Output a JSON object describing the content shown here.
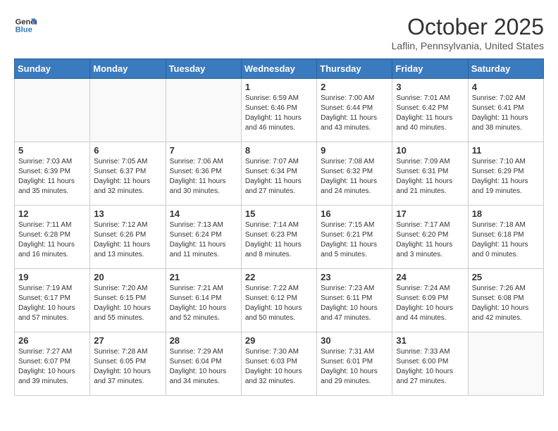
{
  "header": {
    "logo_line1": "General",
    "logo_line2": "Blue",
    "month_title": "October 2025",
    "subtitle": "Laflin, Pennsylvania, United States"
  },
  "weekdays": [
    "Sunday",
    "Monday",
    "Tuesday",
    "Wednesday",
    "Thursday",
    "Friday",
    "Saturday"
  ],
  "weeks": [
    [
      {
        "day": "",
        "info": ""
      },
      {
        "day": "",
        "info": ""
      },
      {
        "day": "",
        "info": ""
      },
      {
        "day": "1",
        "info": "Sunrise: 6:59 AM\nSunset: 6:46 PM\nDaylight: 11 hours\nand 46 minutes."
      },
      {
        "day": "2",
        "info": "Sunrise: 7:00 AM\nSunset: 6:44 PM\nDaylight: 11 hours\nand 43 minutes."
      },
      {
        "day": "3",
        "info": "Sunrise: 7:01 AM\nSunset: 6:42 PM\nDaylight: 11 hours\nand 40 minutes."
      },
      {
        "day": "4",
        "info": "Sunrise: 7:02 AM\nSunset: 6:41 PM\nDaylight: 11 hours\nand 38 minutes."
      }
    ],
    [
      {
        "day": "5",
        "info": "Sunrise: 7:03 AM\nSunset: 6:39 PM\nDaylight: 11 hours\nand 35 minutes."
      },
      {
        "day": "6",
        "info": "Sunrise: 7:05 AM\nSunset: 6:37 PM\nDaylight: 11 hours\nand 32 minutes."
      },
      {
        "day": "7",
        "info": "Sunrise: 7:06 AM\nSunset: 6:36 PM\nDaylight: 11 hours\nand 30 minutes."
      },
      {
        "day": "8",
        "info": "Sunrise: 7:07 AM\nSunset: 6:34 PM\nDaylight: 11 hours\nand 27 minutes."
      },
      {
        "day": "9",
        "info": "Sunrise: 7:08 AM\nSunset: 6:32 PM\nDaylight: 11 hours\nand 24 minutes."
      },
      {
        "day": "10",
        "info": "Sunrise: 7:09 AM\nSunset: 6:31 PM\nDaylight: 11 hours\nand 21 minutes."
      },
      {
        "day": "11",
        "info": "Sunrise: 7:10 AM\nSunset: 6:29 PM\nDaylight: 11 hours\nand 19 minutes."
      }
    ],
    [
      {
        "day": "12",
        "info": "Sunrise: 7:11 AM\nSunset: 6:28 PM\nDaylight: 11 hours\nand 16 minutes."
      },
      {
        "day": "13",
        "info": "Sunrise: 7:12 AM\nSunset: 6:26 PM\nDaylight: 11 hours\nand 13 minutes."
      },
      {
        "day": "14",
        "info": "Sunrise: 7:13 AM\nSunset: 6:24 PM\nDaylight: 11 hours\nand 11 minutes."
      },
      {
        "day": "15",
        "info": "Sunrise: 7:14 AM\nSunset: 6:23 PM\nDaylight: 11 hours\nand 8 minutes."
      },
      {
        "day": "16",
        "info": "Sunrise: 7:15 AM\nSunset: 6:21 PM\nDaylight: 11 hours\nand 5 minutes."
      },
      {
        "day": "17",
        "info": "Sunrise: 7:17 AM\nSunset: 6:20 PM\nDaylight: 11 hours\nand 3 minutes."
      },
      {
        "day": "18",
        "info": "Sunrise: 7:18 AM\nSunset: 6:18 PM\nDaylight: 11 hours\nand 0 minutes."
      }
    ],
    [
      {
        "day": "19",
        "info": "Sunrise: 7:19 AM\nSunset: 6:17 PM\nDaylight: 10 hours\nand 57 minutes."
      },
      {
        "day": "20",
        "info": "Sunrise: 7:20 AM\nSunset: 6:15 PM\nDaylight: 10 hours\nand 55 minutes."
      },
      {
        "day": "21",
        "info": "Sunrise: 7:21 AM\nSunset: 6:14 PM\nDaylight: 10 hours\nand 52 minutes."
      },
      {
        "day": "22",
        "info": "Sunrise: 7:22 AM\nSunset: 6:12 PM\nDaylight: 10 hours\nand 50 minutes."
      },
      {
        "day": "23",
        "info": "Sunrise: 7:23 AM\nSunset: 6:11 PM\nDaylight: 10 hours\nand 47 minutes."
      },
      {
        "day": "24",
        "info": "Sunrise: 7:24 AM\nSunset: 6:09 PM\nDaylight: 10 hours\nand 44 minutes."
      },
      {
        "day": "25",
        "info": "Sunrise: 7:26 AM\nSunset: 6:08 PM\nDaylight: 10 hours\nand 42 minutes."
      }
    ],
    [
      {
        "day": "26",
        "info": "Sunrise: 7:27 AM\nSunset: 6:07 PM\nDaylight: 10 hours\nand 39 minutes."
      },
      {
        "day": "27",
        "info": "Sunrise: 7:28 AM\nSunset: 6:05 PM\nDaylight: 10 hours\nand 37 minutes."
      },
      {
        "day": "28",
        "info": "Sunrise: 7:29 AM\nSunset: 6:04 PM\nDaylight: 10 hours\nand 34 minutes."
      },
      {
        "day": "29",
        "info": "Sunrise: 7:30 AM\nSunset: 6:03 PM\nDaylight: 10 hours\nand 32 minutes."
      },
      {
        "day": "30",
        "info": "Sunrise: 7:31 AM\nSunset: 6:01 PM\nDaylight: 10 hours\nand 29 minutes."
      },
      {
        "day": "31",
        "info": "Sunrise: 7:33 AM\nSunset: 6:00 PM\nDaylight: 10 hours\nand 27 minutes."
      },
      {
        "day": "",
        "info": ""
      }
    ]
  ]
}
